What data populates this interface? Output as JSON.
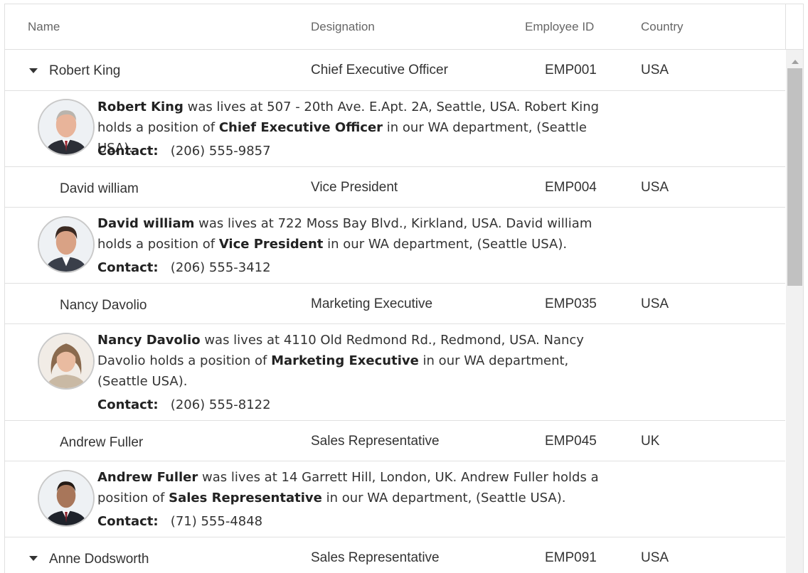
{
  "columns": {
    "name": "Name",
    "designation": "Designation",
    "employee_id": "Employee ID",
    "country": "Country"
  },
  "contact_label": "Contact:",
  "desc_mid1": "was lives at",
  "desc_mid2": "holds a position of",
  "desc_end": "in our WA department, (Seattle USA).",
  "rows": [
    {
      "name": "Robert King",
      "designation": "Chief Executive Officer",
      "id": "EMP001",
      "country": "USA",
      "expanded": true,
      "address": "507 - 20th Ave. E.Apt. 2A, Seattle, USA.",
      "phone": "(206) 555-9857",
      "avatar_icon": "person-photo-icon"
    },
    {
      "name": "David william",
      "designation": "Vice President",
      "id": "EMP004",
      "country": "USA",
      "expanded": false,
      "address": "722 Moss Bay Blvd., Kirkland, USA.",
      "phone": "(206) 555-3412",
      "avatar_icon": "person-photo-icon"
    },
    {
      "name": "Nancy Davolio",
      "designation": "Marketing Executive",
      "id": "EMP035",
      "country": "USA",
      "expanded": false,
      "address": "4110 Old Redmond Rd., Redmond, USA.",
      "phone": "(206) 555-8122",
      "avatar_icon": "person-photo-icon"
    },
    {
      "name": "Andrew Fuller",
      "designation": "Sales Representative",
      "id": "EMP045",
      "country": "UK",
      "expanded": false,
      "address": "14 Garrett Hill, London, UK.",
      "phone": "(71) 555-4848",
      "avatar_icon": "person-photo-icon"
    },
    {
      "name": "Anne Dodsworth",
      "designation": "Sales Representative",
      "id": "EMP091",
      "country": "USA",
      "expanded": true
    }
  ],
  "colors": {
    "border": "#e0e0e0",
    "header_text": "#666666",
    "text": "#333333",
    "scroll_track": "#f1f1f1",
    "scroll_thumb": "#c1c1c1"
  }
}
